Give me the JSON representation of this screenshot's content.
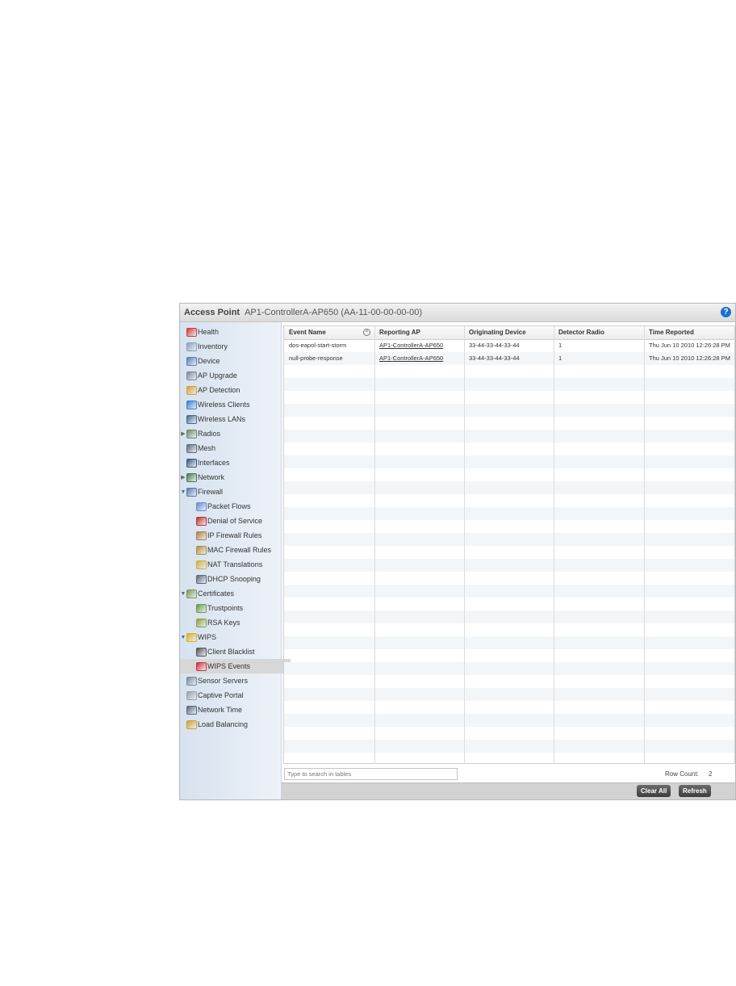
{
  "window": {
    "title": "Access Point",
    "subtitle": "AP1-ControllerA-AP650 (AA-11-00-00-00-00)",
    "help_icon": "?"
  },
  "sidebar": {
    "items": [
      {
        "label": "Health",
        "icon": "health-icon",
        "indent": 0,
        "arrow": ""
      },
      {
        "label": "Inventory",
        "icon": "inventory-icon",
        "indent": 0,
        "arrow": ""
      },
      {
        "label": "Device",
        "icon": "device-icon",
        "indent": 0,
        "arrow": ""
      },
      {
        "label": "AP Upgrade",
        "icon": "ap-upgrade-icon",
        "indent": 0,
        "arrow": ""
      },
      {
        "label": "AP Detection",
        "icon": "ap-detection-icon",
        "indent": 0,
        "arrow": ""
      },
      {
        "label": "Wireless Clients",
        "icon": "wireless-clients-icon",
        "indent": 0,
        "arrow": ""
      },
      {
        "label": "Wireless LANs",
        "icon": "wireless-lans-icon",
        "indent": 0,
        "arrow": ""
      },
      {
        "label": "Radios",
        "icon": "radios-icon",
        "indent": 0,
        "arrow": "▶"
      },
      {
        "label": "Mesh",
        "icon": "mesh-icon",
        "indent": 0,
        "arrow": ""
      },
      {
        "label": "Interfaces",
        "icon": "interfaces-icon",
        "indent": 0,
        "arrow": ""
      },
      {
        "label": "Network",
        "icon": "network-icon",
        "indent": 0,
        "arrow": "▶"
      },
      {
        "label": "Firewall",
        "icon": "firewall-icon",
        "indent": 0,
        "arrow": "▼"
      },
      {
        "label": "Packet Flows",
        "icon": "packet-flows-icon",
        "indent": 1,
        "arrow": ""
      },
      {
        "label": "Denial of Service",
        "icon": "denial-of-service-icon",
        "indent": 1,
        "arrow": ""
      },
      {
        "label": "IP Firewall Rules",
        "icon": "ip-firewall-rules-icon",
        "indent": 1,
        "arrow": ""
      },
      {
        "label": "MAC Firewall Rules",
        "icon": "mac-firewall-rules-icon",
        "indent": 1,
        "arrow": ""
      },
      {
        "label": "NAT Translations",
        "icon": "nat-translations-icon",
        "indent": 1,
        "arrow": ""
      },
      {
        "label": "DHCP Snooping",
        "icon": "dhcp-snooping-icon",
        "indent": 1,
        "arrow": ""
      },
      {
        "label": "Certificates",
        "icon": "certificates-icon",
        "indent": 0,
        "arrow": "▼"
      },
      {
        "label": "Trustpoints",
        "icon": "trustpoints-icon",
        "indent": 1,
        "arrow": ""
      },
      {
        "label": "RSA Keys",
        "icon": "rsa-keys-icon",
        "indent": 1,
        "arrow": ""
      },
      {
        "label": "WIPS",
        "icon": "wips-icon",
        "indent": 0,
        "arrow": "▼"
      },
      {
        "label": "Client Blacklist",
        "icon": "client-blacklist-icon",
        "indent": 1,
        "arrow": ""
      },
      {
        "label": "WIPS Events",
        "icon": "wips-events-icon",
        "indent": 1,
        "arrow": "",
        "selected": true
      },
      {
        "label": "Sensor Servers",
        "icon": "sensor-servers-icon",
        "indent": 0,
        "arrow": ""
      },
      {
        "label": "Captive Portal",
        "icon": "captive-portal-icon",
        "indent": 0,
        "arrow": ""
      },
      {
        "label": "Network Time",
        "icon": "network-time-icon",
        "indent": 0,
        "arrow": ""
      },
      {
        "label": "Load Balancing",
        "icon": "load-balancing-icon",
        "indent": 0,
        "arrow": ""
      }
    ]
  },
  "table": {
    "columns": [
      "Event Name",
      "Reporting AP",
      "Originating Device",
      "Detector Radio",
      "Time Reported"
    ],
    "rows": [
      [
        "dos-eapol-start-storm",
        "AP1-ControllerA-AP650",
        "33-44-33-44-33-44",
        "1",
        "Thu Jun 10 2010 12:26:28 PM"
      ],
      [
        "null-probe-response",
        "AP1-ControllerA-AP650",
        "33-44-33-44-33-44",
        "1",
        "Thu Jun 10 2010 12:26:28 PM"
      ]
    ],
    "search_placeholder": "Type to search in tables",
    "row_count_label": "Row Count:",
    "row_count_value": "2"
  },
  "buttons": {
    "clear_all": "Clear All",
    "refresh": "Refresh"
  },
  "colors": {
    "help": "#1a6fd0",
    "selected_nav": "#d7d7d7"
  }
}
